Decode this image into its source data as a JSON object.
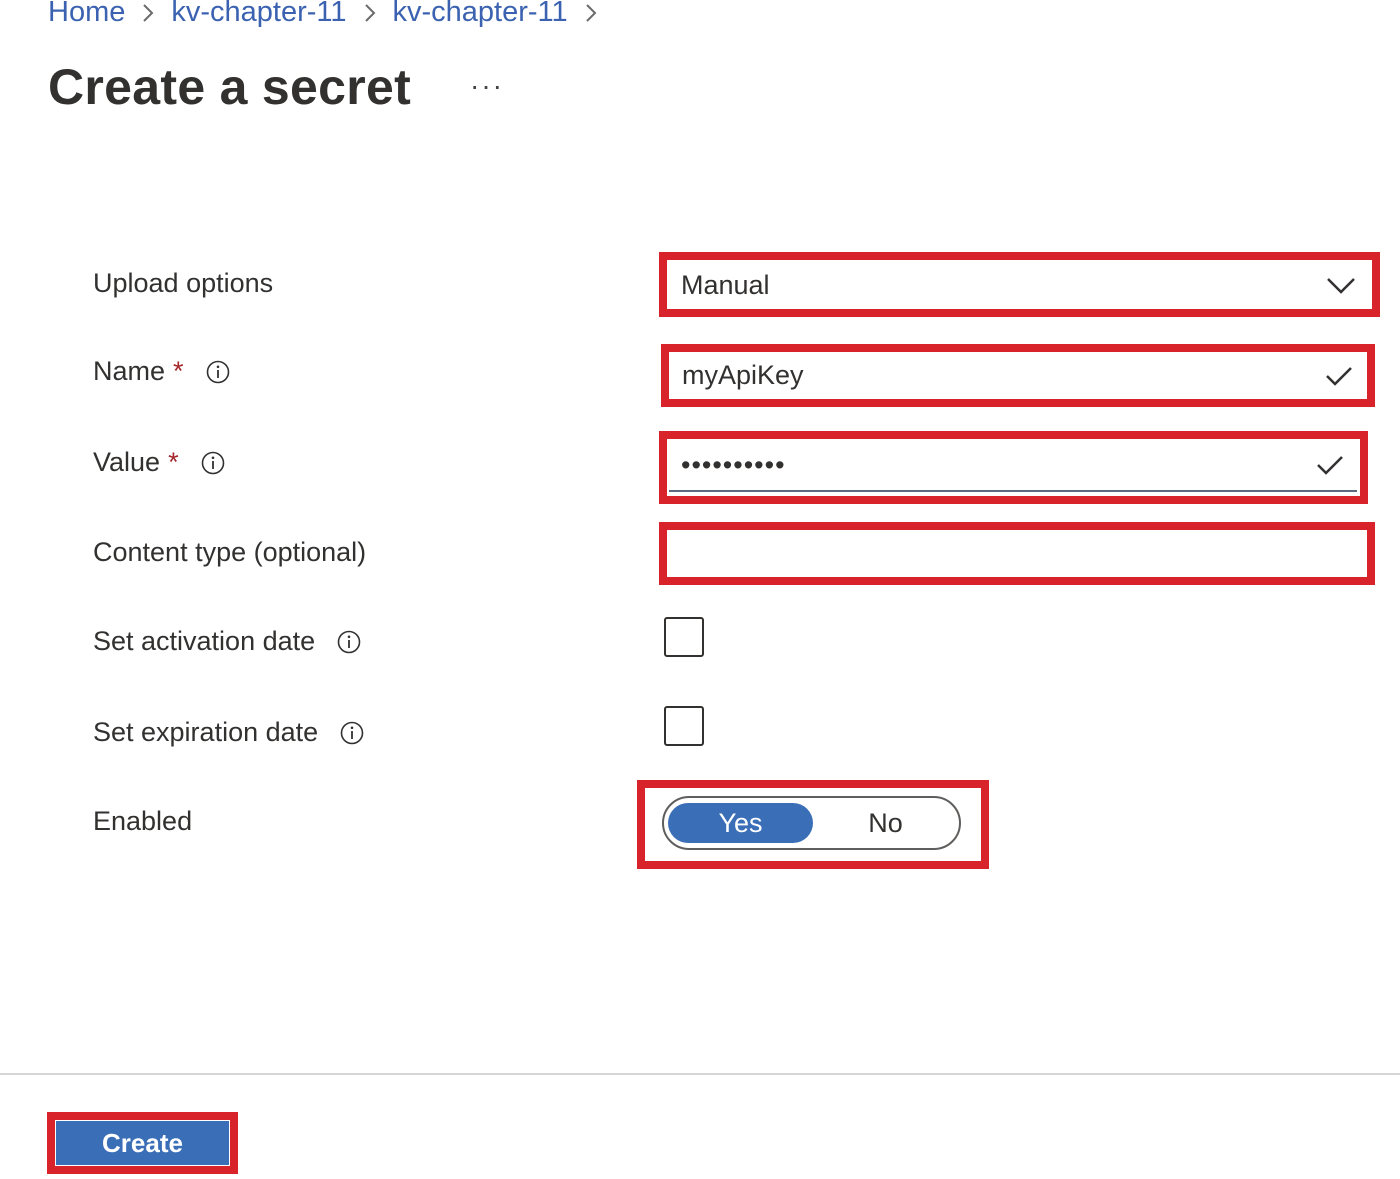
{
  "breadcrumb": {
    "items": [
      {
        "label": "Home"
      },
      {
        "label": "kv-chapter-11"
      },
      {
        "label": "kv-chapter-11"
      }
    ]
  },
  "header": {
    "title": "Create a secret",
    "more_label": "···"
  },
  "form": {
    "upload_options": {
      "label": "Upload options",
      "value": "Manual"
    },
    "name": {
      "label": "Name",
      "required_mark": "*",
      "value": "myApiKey"
    },
    "value": {
      "label": "Value",
      "required_mark": "*",
      "value": "••••••••••"
    },
    "content_type": {
      "label": "Content type (optional)",
      "value": ""
    },
    "activation_date": {
      "label": "Set activation date",
      "checked": false
    },
    "expiration_date": {
      "label": "Set expiration date",
      "checked": false
    },
    "enabled": {
      "label": "Enabled",
      "options": [
        "Yes",
        "No"
      ],
      "selected": "Yes"
    }
  },
  "footer": {
    "create_label": "Create"
  },
  "icons": {
    "breadcrumb_separator": "chevron-right-icon",
    "dropdown": "chevron-down-icon",
    "valid": "checkmark-icon",
    "info": "info-icon"
  },
  "colors": {
    "accent": "#3a6fb8",
    "highlight": "#d9232a",
    "link": "#3b62b0",
    "required": "#a4262c"
  }
}
